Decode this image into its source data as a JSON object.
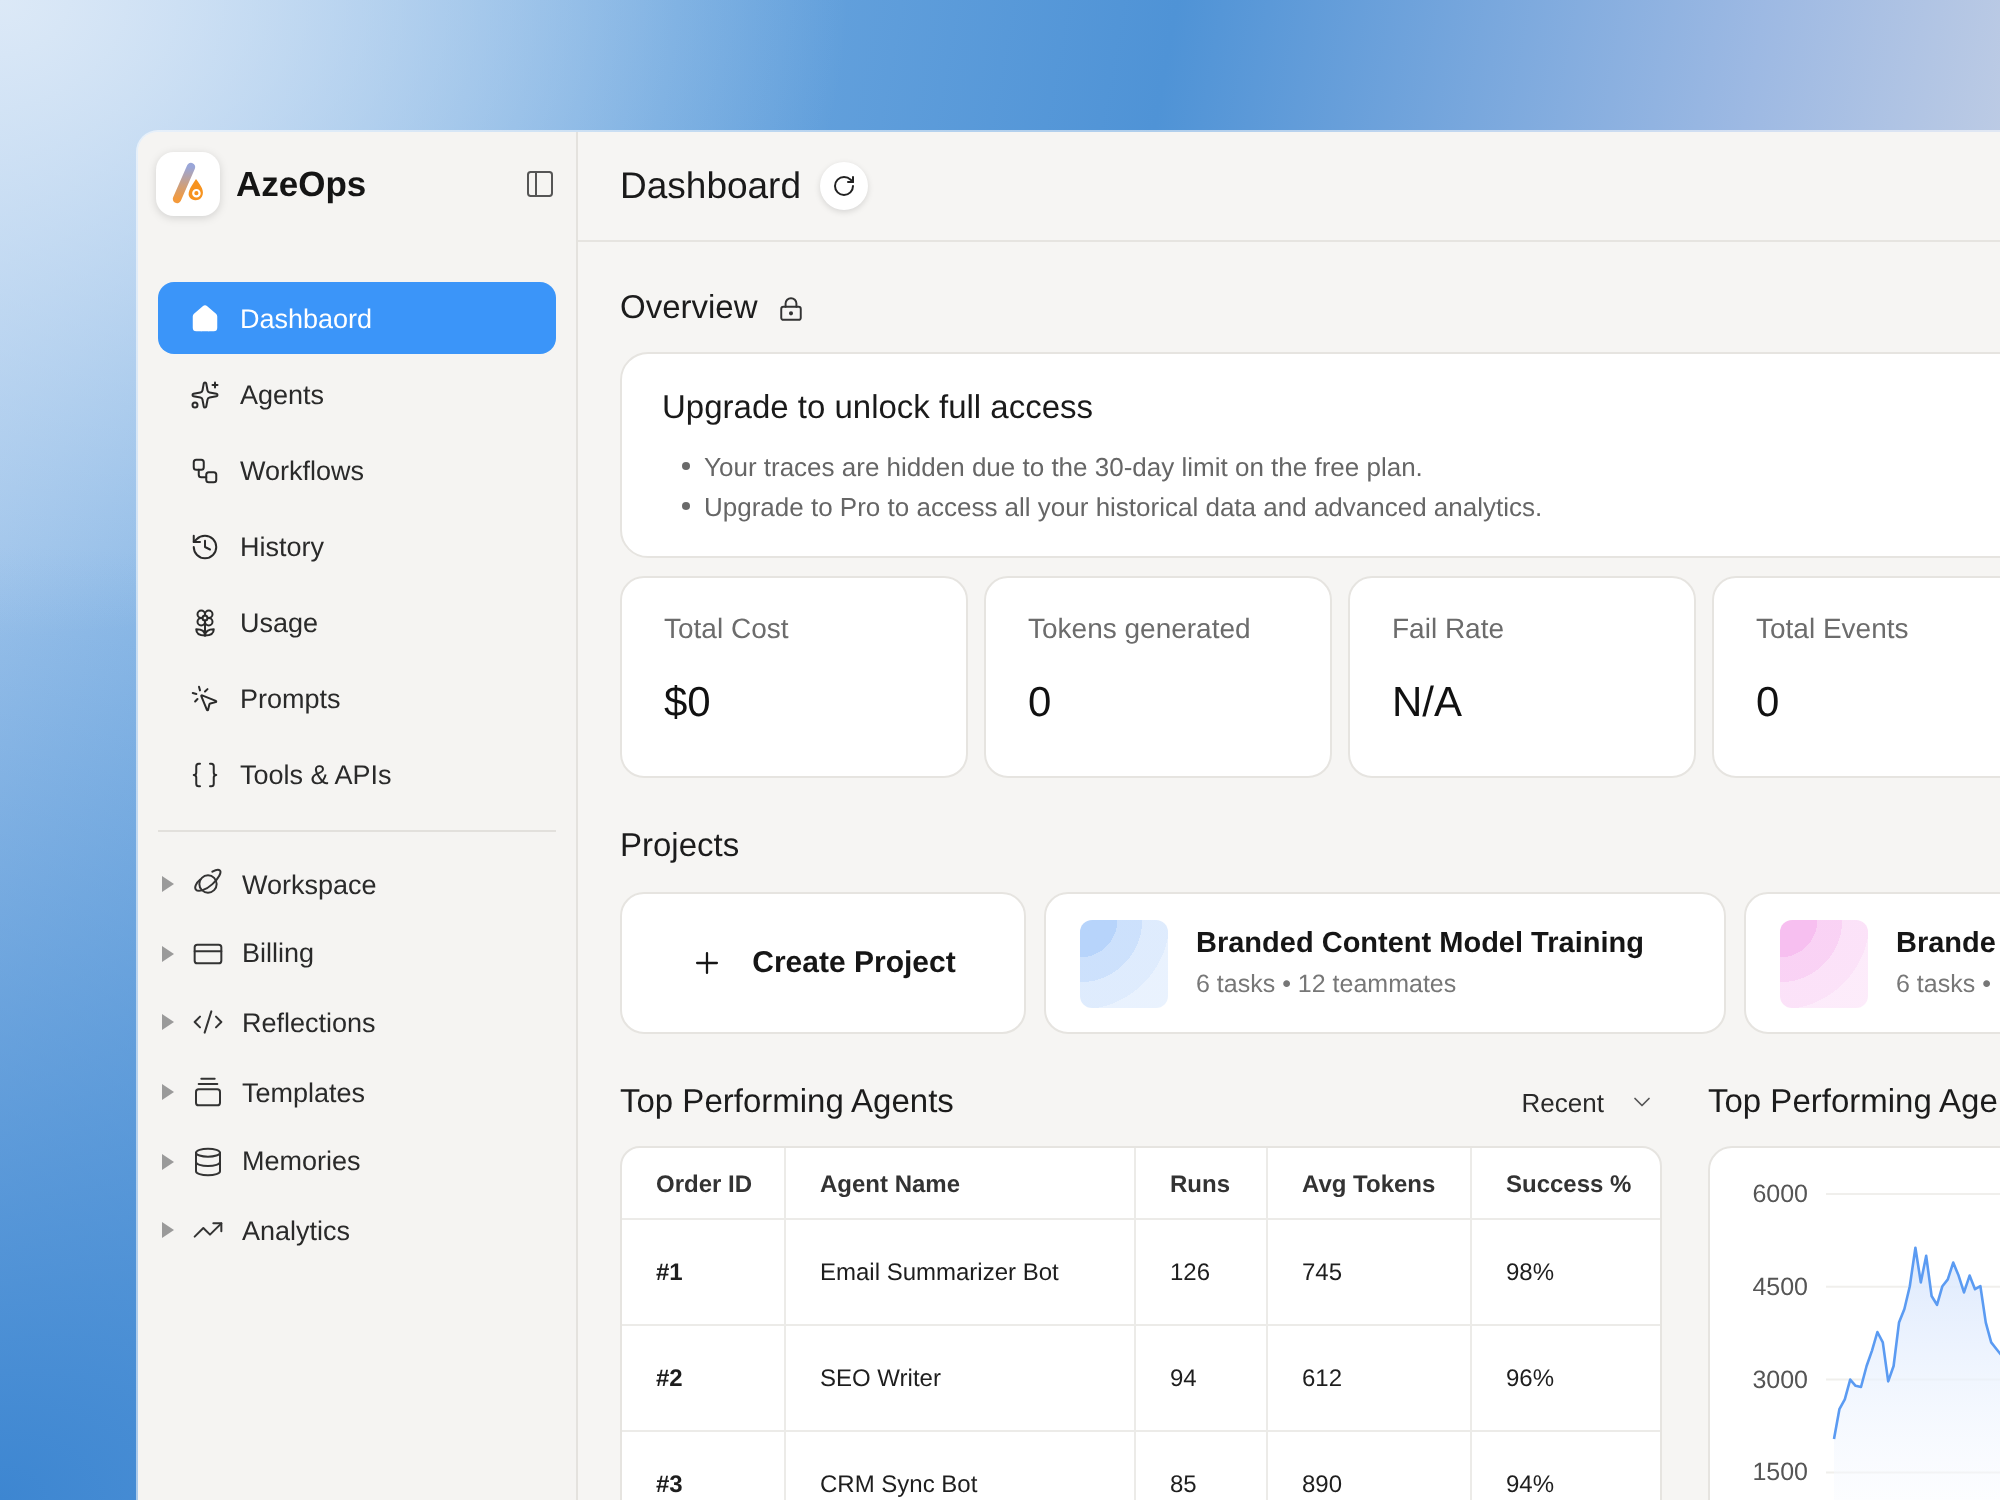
{
  "sidebar": {
    "brand": "AzeOps",
    "nav": [
      {
        "label": "Dashbaord",
        "selected": true
      },
      {
        "label": "Agents",
        "selected": false
      },
      {
        "label": "Workflows",
        "selected": false
      },
      {
        "label": "History",
        "selected": false
      },
      {
        "label": "Usage",
        "selected": false
      },
      {
        "label": "Prompts",
        "selected": false
      },
      {
        "label": "Tools & APIs",
        "selected": false
      }
    ],
    "groups": [
      {
        "label": "Workspace",
        "expanded": false
      },
      {
        "label": "Billing",
        "expanded": false
      },
      {
        "label": "Reflections",
        "expanded": false
      },
      {
        "label": "Templates",
        "expanded": false
      },
      {
        "label": "Memories",
        "expanded": false
      },
      {
        "label": "Analytics",
        "expanded": false
      }
    ]
  },
  "header": {
    "title": "Dashboard"
  },
  "overview": {
    "title": "Overview",
    "notice": {
      "title": "Upgrade to unlock full access",
      "bullets": [
        "Your traces are hidden due to the 30-day limit on the free plan.",
        "Upgrade to Pro to access all your historical data and advanced analytics."
      ]
    },
    "stats": [
      {
        "label": "Total Cost",
        "value": "$0"
      },
      {
        "label": "Tokens generated",
        "value": "0"
      },
      {
        "label": "Fail Rate",
        "value": "N/A"
      },
      {
        "label": "Total Events",
        "value": "0"
      }
    ]
  },
  "projects": {
    "title": "Projects",
    "create_label": "Create Project",
    "items": [
      {
        "title": "Branded Content Model Training",
        "meta": "6 tasks • 12 teammates",
        "color": "#b7d4fb"
      },
      {
        "title": "Brande",
        "meta": "6 tasks •",
        "color": "#f7bff0"
      }
    ]
  },
  "agents_table": {
    "title": "Top Performing Agents",
    "sort": "Recent",
    "columns": [
      "Order ID",
      "Agent Name",
      "Runs",
      "Avg Tokens",
      "Success %"
    ],
    "rows": [
      [
        "#1",
        "Email Summarizer Bot",
        "126",
        "745",
        "98%"
      ],
      [
        "#2",
        "SEO Writer",
        "94",
        "612",
        "96%"
      ],
      [
        "#3",
        "CRM Sync Bot",
        "85",
        "890",
        "94%"
      ]
    ]
  },
  "agents_chart": {
    "title": "Top Performing Age",
    "chart_data": {
      "type": "area",
      "grid": true,
      "ylim": [
        0,
        6000
      ],
      "yticks": [
        1500,
        3000,
        4500,
        6000
      ],
      "values": [
        2040,
        2520,
        2680,
        3000,
        2900,
        2880,
        3220,
        3470,
        3770,
        3600,
        2970,
        3220,
        3920,
        4140,
        4510,
        5130,
        4570,
        5000,
        4350,
        4210,
        4510,
        4620,
        4890,
        4680,
        4410,
        4680,
        4460,
        4510,
        3920,
        3600,
        3490,
        3380
      ]
    }
  }
}
